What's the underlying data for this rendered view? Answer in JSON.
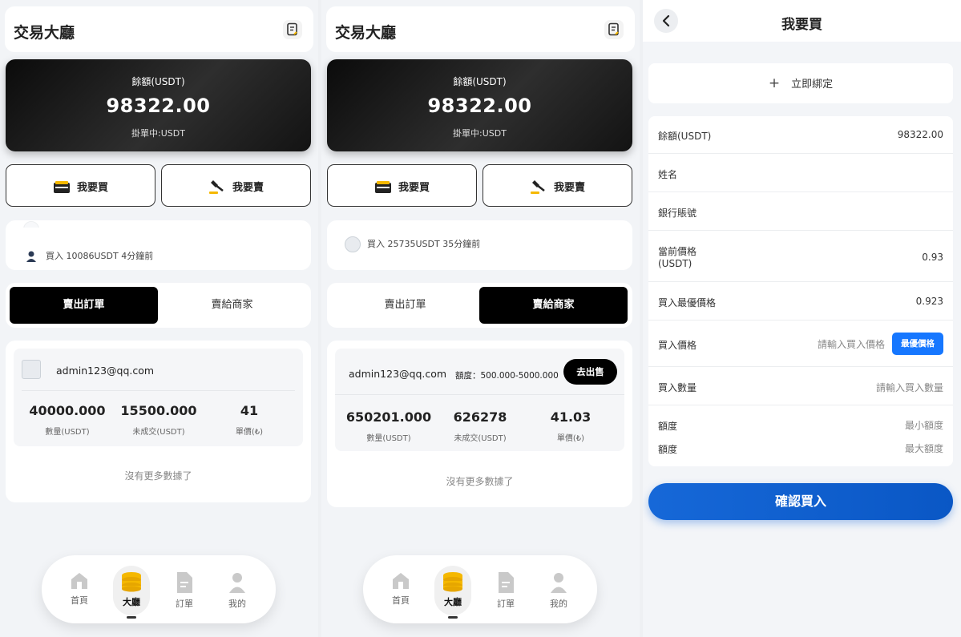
{
  "app": {
    "title": "交易大廳",
    "balance_label": "餘額(USDT)",
    "balance_value": "98322.00",
    "pending_label": "掛單中:USDT",
    "buy_label": "我要買",
    "sell_label": "我要賣",
    "no_more": "沒有更多數據了"
  },
  "nav": {
    "items": [
      {
        "label": "首頁",
        "icon": "home-icon"
      },
      {
        "label": "大廳",
        "icon": "coins-icon"
      },
      {
        "label": "訂單",
        "icon": "document-icon"
      },
      {
        "label": "我的",
        "icon": "user-icon"
      }
    ]
  },
  "panel1": {
    "ticker": [
      "買入 10086USDT 4分鐘前"
    ],
    "tabs": [
      "賣出訂單",
      "賣給商家"
    ],
    "active_tab": 0,
    "merchant": {
      "email": "admin123@qq.com",
      "stats": [
        {
          "value": "40000.000",
          "label": "數量(USDT)"
        },
        {
          "value": "15500.000",
          "label": "未成交(USDT)"
        },
        {
          "value": "41",
          "label": "單價(₺)"
        }
      ]
    }
  },
  "panel2": {
    "ticker": [
      "買入 25735USDT 35分鐘前"
    ],
    "tabs": [
      "賣出訂單",
      "賣給商家"
    ],
    "active_tab": 1,
    "merchant": {
      "email": "admin123@qq.com",
      "limit": "額度：500.000-5000.000",
      "action": "去出售",
      "stats": [
        {
          "value": "650201.000",
          "label": "數量(USDT)"
        },
        {
          "value": "626278",
          "label": "未成交(USDT)"
        },
        {
          "value": "41.03",
          "label": "單價(₺)"
        }
      ]
    }
  },
  "panel3": {
    "title": "我要買",
    "bind_label": "立即綁定",
    "fields": {
      "balance": {
        "label": "餘額(USDT)",
        "value": "98322.00"
      },
      "name": {
        "label": "姓名"
      },
      "bank": {
        "label": "銀行賬號"
      },
      "current_price": {
        "label_line1": "當前價格",
        "label_line2": "(USDT)",
        "value": "0.93"
      },
      "best_price": {
        "label": "買入最優價格",
        "value": "0.923"
      },
      "buy_price": {
        "label": "買入價格",
        "placeholder": "請輸入買入價格",
        "button": "最優價格"
      },
      "quantity": {
        "label": "買入數量",
        "placeholder": "請輸入買入數量"
      },
      "limit_min": {
        "label": "額度",
        "placeholder": "最小額度"
      },
      "limit_max": {
        "label": "額度",
        "placeholder": "最大額度"
      }
    },
    "confirm_label": "確認買入"
  },
  "colors": {
    "accent_blue": "#1677ff",
    "dark": "#000000",
    "gold": "#f5b800"
  }
}
